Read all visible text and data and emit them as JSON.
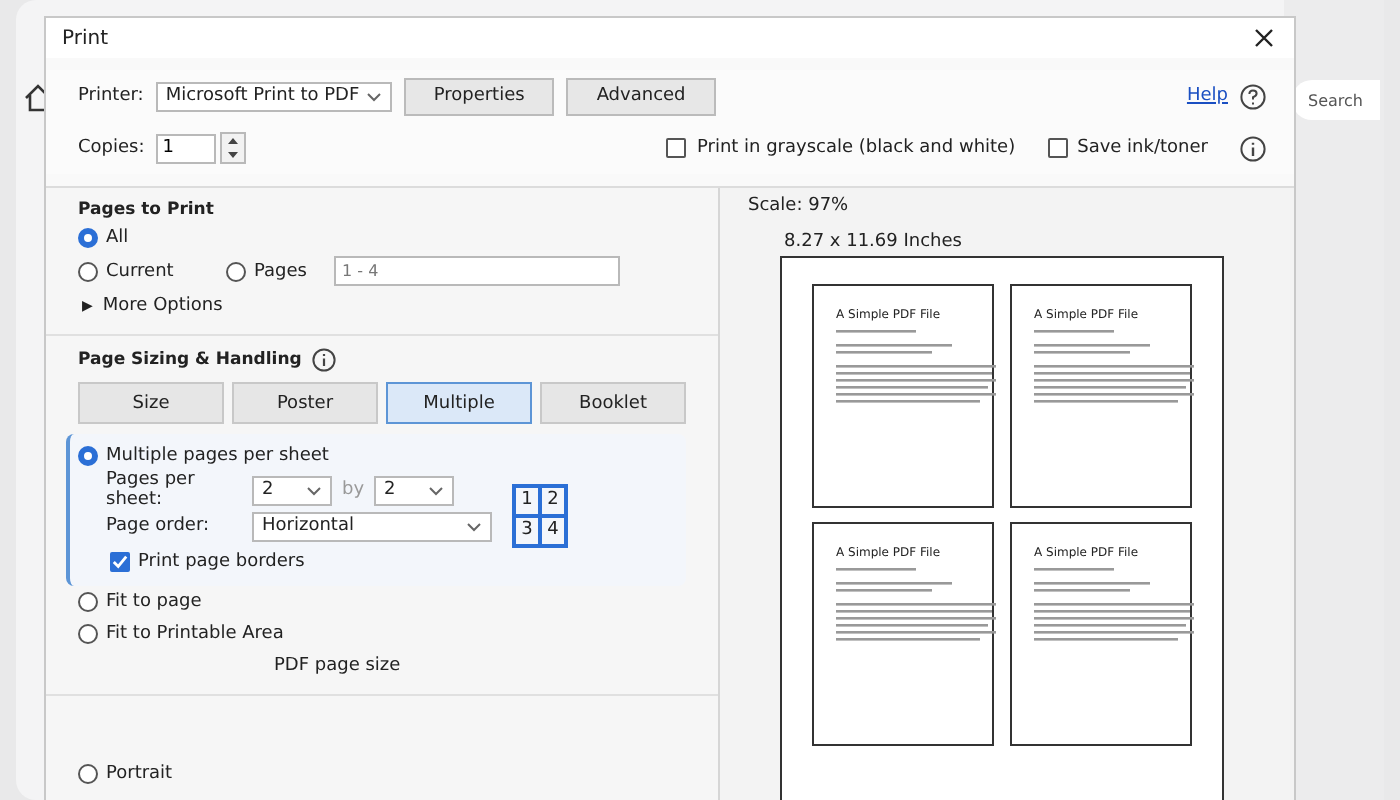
{
  "background": {
    "search_placeholder": "Search"
  },
  "dialog": {
    "title": "Print",
    "printer": {
      "label": "Printer:",
      "value": "Microsoft Print to PDF"
    },
    "buttons": [
      "Properties",
      "Advanced"
    ],
    "help": "Help",
    "copies": {
      "label": "Copies:",
      "value": "1"
    },
    "options": [
      {
        "label": "Print in grayscale (black and white)",
        "checked": false
      },
      {
        "label": "Save ink/toner",
        "checked": false
      }
    ],
    "pages_to_print": {
      "title": "Pages to Print",
      "choices": [
        {
          "label": "All",
          "selected": true
        },
        {
          "label": "Current",
          "selected": false
        },
        {
          "label": "Pages",
          "selected": false
        }
      ],
      "pages_value": "1 - 4",
      "more_options": {
        "marker": "▶",
        "label": "More Options"
      }
    },
    "sizing": {
      "title": "Page Sizing & Handling",
      "tabs": [
        {
          "label": "Size",
          "selected": false
        },
        {
          "label": "Poster",
          "selected": false
        },
        {
          "label": "Multiple",
          "selected": true
        },
        {
          "label": "Booklet",
          "selected": false
        }
      ],
      "multiple": {
        "label": "Multiple pages per sheet",
        "selected": true,
        "per_sheet_label": "Pages per sheet:",
        "columns": "2",
        "by": "by",
        "rows": "2",
        "order_label": "Page order:",
        "order": "Horizontal",
        "grid": [
          "1",
          "2",
          "3",
          "4"
        ],
        "borders": {
          "label": "Print page borders",
          "checked": true
        }
      },
      "other_modes": [
        {
          "label": "Fit to page",
          "selected": false
        },
        {
          "label": "Fit to Printable Area",
          "selected": false
        }
      ],
      "paper_note": "PDF page size"
    },
    "orientation": [
      {
        "label": "Portrait",
        "selected": false
      }
    ],
    "preview": {
      "scale": "Scale:  97%",
      "size": "8.27 x 11.69 Inches",
      "pages": [
        {
          "title": "A Simple PDF File"
        },
        {
          "title": "A Simple PDF File"
        },
        {
          "title": "A Simple PDF File"
        },
        {
          "title": "A Simple PDF File"
        }
      ]
    }
  }
}
